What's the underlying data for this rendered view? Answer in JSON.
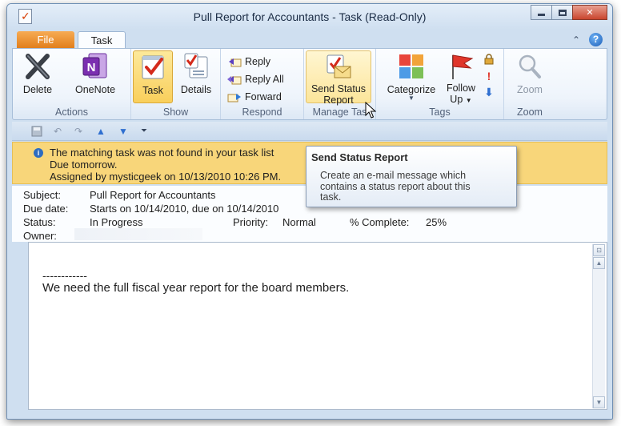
{
  "window": {
    "title": "Pull Report for Accountants  -  Task  (Read-Only)"
  },
  "tabs": {
    "file": "File",
    "task": "Task"
  },
  "ribbon": {
    "actions": {
      "label": "Actions",
      "delete": "Delete",
      "onenote": "OneNote"
    },
    "show": {
      "label": "Show",
      "task": "Task",
      "details": "Details"
    },
    "respond": {
      "label": "Respond",
      "reply": "Reply",
      "reply_all": "Reply All",
      "forward": "Forward"
    },
    "manage_task": {
      "label": "Manage Tas",
      "send_status_line1": "Send Status",
      "send_status_line2": "Report"
    },
    "tags": {
      "label": "Tags",
      "categorize": "Categorize",
      "follow_line1": "Follow",
      "follow_line2": "Up"
    },
    "zoom": {
      "label": "Zoom",
      "zoom": "Zoom"
    }
  },
  "infobar": {
    "line1": "The matching task was not found in your task list",
    "line2": "Due tomorrow.",
    "line3": "Assigned by mysticgeek on 10/13/2010 10:26 PM."
  },
  "fields": {
    "subject_label": "Subject:",
    "subject_value": "Pull Report for Accountants",
    "due_label": "Due date:",
    "due_value": "Starts on 10/14/2010, due on 10/14/2010",
    "status_label": "Status:",
    "status_value": "In Progress",
    "priority_label": "Priority:",
    "priority_value": "Normal",
    "complete_label": "% Complete:",
    "complete_value": "25%",
    "owner_label": "Owner:"
  },
  "body": {
    "dashes": "------------",
    "text": "We need the full fiscal year report for the board members."
  },
  "tooltip": {
    "title": "Send Status Report",
    "body": "Create an e-mail message which\ncontains a status report about this\ntask."
  },
  "colors": {
    "file_tab": "#e07d19",
    "infobar": "#f8d67a",
    "close_button": "#c9452e"
  }
}
